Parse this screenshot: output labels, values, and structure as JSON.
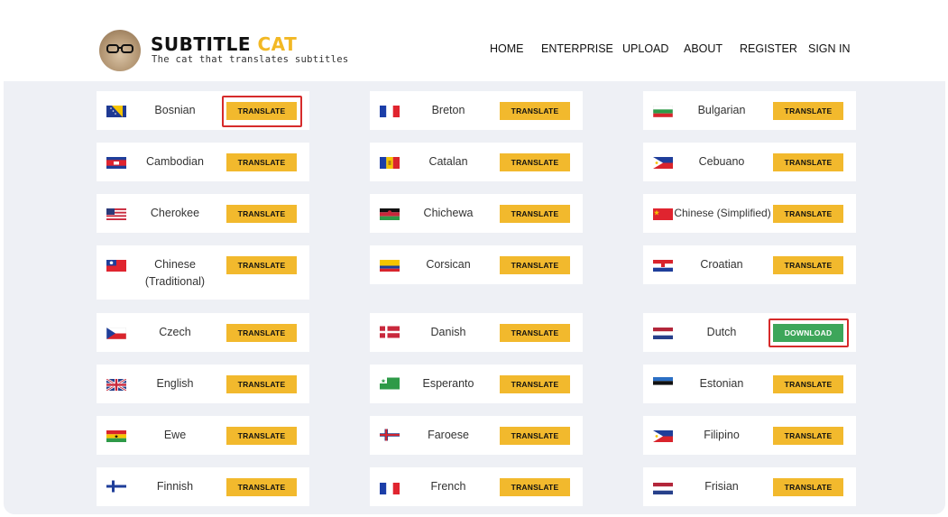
{
  "brand": {
    "title_main": "SUBTITLE",
    "title_accent": "CAT",
    "tagline": "The cat that translates subtitles"
  },
  "nav": [
    {
      "label": "HOME"
    },
    {
      "label": "ENTERPRISE"
    },
    {
      "label": "UPLOAD"
    },
    {
      "label": "ABOUT"
    },
    {
      "label": "REGISTER"
    },
    {
      "label": "SIGN IN"
    }
  ],
  "languages": [
    {
      "name": "Bosnian",
      "button": "TRANSLATE",
      "flag": "bosnia-flag",
      "highlighted": true
    },
    {
      "name": "Breton",
      "button": "TRANSLATE",
      "flag": "brittany-flag"
    },
    {
      "name": "Bulgarian",
      "button": "TRANSLATE",
      "flag": "bulgaria-flag"
    },
    {
      "name": "Cambodian",
      "button": "TRANSLATE",
      "flag": "cambodia-flag"
    },
    {
      "name": "Catalan",
      "button": "TRANSLATE",
      "flag": "andorra-flag"
    },
    {
      "name": "Cebuano",
      "button": "TRANSLATE",
      "flag": "philippines-flag"
    },
    {
      "name": "Cherokee",
      "button": "TRANSLATE",
      "flag": "usa-flag"
    },
    {
      "name": "Chichewa",
      "button": "TRANSLATE",
      "flag": "malawi-flag"
    },
    {
      "name": "Chinese (Simplified)",
      "button": "TRANSLATE",
      "flag": "china-flag"
    },
    {
      "name": "Chinese",
      "name_line2": "(Traditional)",
      "button": "TRANSLATE",
      "flag": "taiwan-flag"
    },
    {
      "name": "Corsican",
      "button": "TRANSLATE",
      "flag": "colombia-flag"
    },
    {
      "name": "Croatian",
      "button": "TRANSLATE",
      "flag": "croatia-flag"
    },
    {
      "name": "Czech",
      "button": "TRANSLATE",
      "flag": "czech-flag"
    },
    {
      "name": "Danish",
      "button": "TRANSLATE",
      "flag": "denmark-flag"
    },
    {
      "name": "Dutch",
      "button": "DOWNLOAD",
      "flag": "netherlands-flag",
      "highlighted": true,
      "status_color": "#3da65a"
    },
    {
      "name": "English",
      "button": "TRANSLATE",
      "flag": "uk-flag"
    },
    {
      "name": "Esperanto",
      "button": "TRANSLATE",
      "flag": "esperanto-flag"
    },
    {
      "name": "Estonian",
      "button": "TRANSLATE",
      "flag": "estonia-flag"
    },
    {
      "name": "Ewe",
      "button": "TRANSLATE",
      "flag": "ghana-flag"
    },
    {
      "name": "Faroese",
      "button": "TRANSLATE",
      "flag": "faroe-flag"
    },
    {
      "name": "Filipino",
      "button": "TRANSLATE",
      "flag": "philippines-flag"
    },
    {
      "name": "Finnish",
      "button": "TRANSLATE",
      "flag": "finland-flag"
    },
    {
      "name": "French",
      "button": "TRANSLATE",
      "flag": "france-flag"
    },
    {
      "name": "Frisian",
      "button": "TRANSLATE",
      "flag": "netherlands-flag"
    }
  ],
  "colors": {
    "accent": "#f2b92d",
    "download": "#3da65a",
    "highlight": "#d62b2b",
    "background": "#eef0f5"
  }
}
